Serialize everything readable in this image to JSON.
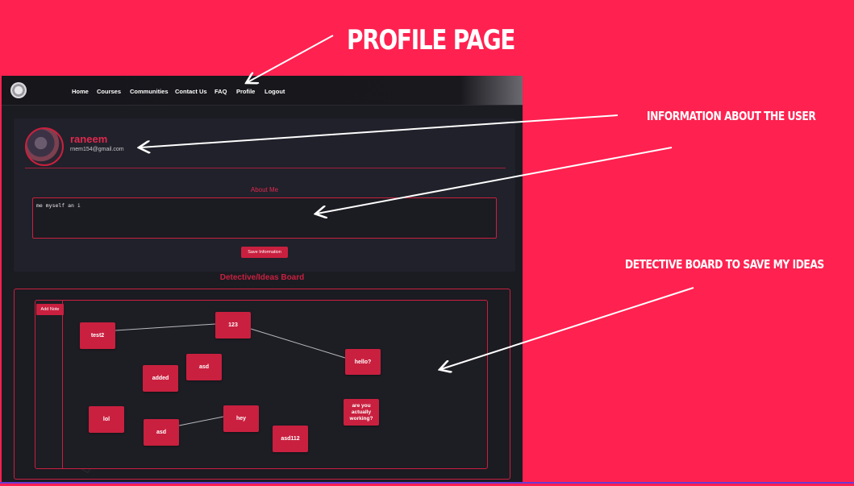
{
  "slide": {
    "title": "PROFILE PAGE",
    "callout_user_info": "INFORMATION ABOUT THE USER",
    "callout_board": "DETECTIVE BOARD TO SAVE MY IDEAS"
  },
  "nav": {
    "items": [
      "Home",
      "Courses",
      "Communities",
      "Contact Us",
      "FAQ",
      "Profile",
      "Logout"
    ]
  },
  "profile": {
    "name": "raneem",
    "email": "rnem154@gmail.com",
    "about_title": "About Me",
    "about_text": "me myself an i",
    "save_label": "Save Information"
  },
  "board": {
    "title": "Detective/Ideas Board",
    "add_note_label": "Add Note",
    "notes": [
      "test2",
      "123",
      "hello?",
      "asd",
      "added",
      "lol",
      "asd",
      "hey",
      "asd112",
      "are you actually working?"
    ]
  },
  "colors": {
    "slide_background": "#ff2150",
    "accent": "#c9203f",
    "app_background": "#1b1b22"
  }
}
